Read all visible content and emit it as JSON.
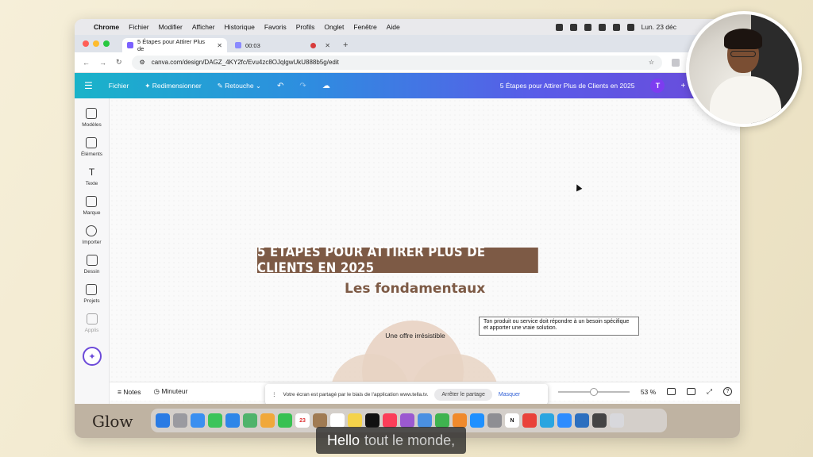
{
  "menubar": {
    "app": "Chrome",
    "items": [
      "Fichier",
      "Modifier",
      "Afficher",
      "Historique",
      "Favoris",
      "Profils",
      "Onglet",
      "Fenêtre",
      "Aide"
    ],
    "clock": "Lun. 23 déc"
  },
  "browser": {
    "tabs": [
      {
        "label": "5 Étapes pour Attirer Plus de"
      },
      {
        "label": "00:03"
      }
    ],
    "url": "canva.com/design/DAGZ_4KY2fc/Evu4zc8OJqlgwUkU888b5g/edit"
  },
  "canva_toolbar": {
    "file": "Fichier",
    "resize": "Redimensionner",
    "edit_mode": "Retouche",
    "doc_title": "5 Étapes pour Attirer Plus de Clients en 2025",
    "avatar_initial": "T"
  },
  "sidebar": {
    "items": [
      {
        "label": "Modèles"
      },
      {
        "label": "Éléments"
      },
      {
        "label": "Texte"
      },
      {
        "label": "Marque"
      },
      {
        "label": "Importer"
      },
      {
        "label": "Dessin"
      },
      {
        "label": "Projets"
      },
      {
        "label": "Applis"
      }
    ]
  },
  "design": {
    "headline": "5 ÉTAPES POUR ATTIRER PLUS DE CLIENTS EN 2025",
    "subheading": "Les fondamentaux",
    "callout": "Ton produit ou service doit répondre à un besoin spécifique et apporter une vraie solution.",
    "venn_label": "Une offre irrésistible"
  },
  "statusbar": {
    "notes": "Notes",
    "timer": "Minuteur",
    "zoom": "53 %",
    "zoom_fraction": 0.53
  },
  "share_banner": {
    "message": "Votre écran est partagé par le biais de l'application www.tella.tv.",
    "stop": "Arrêter le partage",
    "hide": "Masquer"
  },
  "desktop": {
    "background_text": "Glow"
  },
  "caption": {
    "spoken": "Hello",
    "upcoming": "tout le monde,"
  },
  "colors": {
    "brand_brown": "#7d5a45",
    "venn_fill": "#e8d3c3",
    "toolbar_start": "#19b3c9",
    "toolbar_end": "#6c4ad9"
  }
}
